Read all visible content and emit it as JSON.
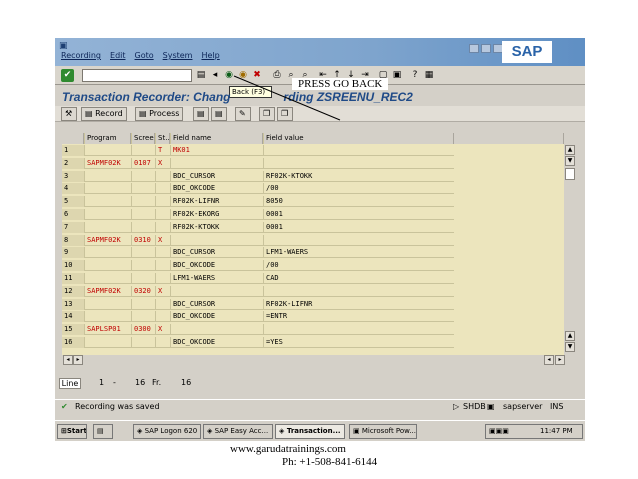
{
  "menu": [
    "Recording",
    "Edit",
    "Goto",
    "System",
    "Help"
  ],
  "logo": "SAP",
  "tooltip": "Back  (F3)",
  "page_title": "Transaction Recorder: Chang",
  "page_title_tail": "rding ZSREENU_REC2",
  "app_toolbar": {
    "record": "Record",
    "process": "Process"
  },
  "annotation": "PRESS GO BACK",
  "table": {
    "headers": [
      "",
      "Program",
      "Screen",
      "St..",
      "Field name",
      "Field value"
    ],
    "rows": [
      [
        "1",
        "",
        "",
        "T",
        "MK01",
        ""
      ],
      [
        "2",
        "SAPMF02K",
        "0107",
        "X",
        "",
        ""
      ],
      [
        "3",
        "",
        "",
        "",
        "BDC_CURSOR",
        "RF02K-KTOKK"
      ],
      [
        "4",
        "",
        "",
        "",
        "BDC_OKCODE",
        "/00"
      ],
      [
        "5",
        "",
        "",
        "",
        "RF02K-LIFNR",
        "8050"
      ],
      [
        "6",
        "",
        "",
        "",
        "RF02K-EKORG",
        "0001"
      ],
      [
        "7",
        "",
        "",
        "",
        "RF02K-KTOKK",
        "0001"
      ],
      [
        "8",
        "SAPMF02K",
        "0310",
        "X",
        "",
        ""
      ],
      [
        "9",
        "",
        "",
        "",
        "BDC_CURSOR",
        "LFM1-WAERS"
      ],
      [
        "10",
        "",
        "",
        "",
        "BDC_OKCODE",
        "/00"
      ],
      [
        "11",
        "",
        "",
        "",
        "LFM1-WAERS",
        "CAD"
      ],
      [
        "12",
        "SAPMF02K",
        "0320",
        "X",
        "",
        ""
      ],
      [
        "13",
        "",
        "",
        "",
        "BDC_CURSOR",
        "RF02K-LIFNR"
      ],
      [
        "14",
        "",
        "",
        "",
        "BDC_OKCODE",
        "=ENTR"
      ],
      [
        "15",
        "SAPLSP01",
        "0300",
        "X",
        "",
        ""
      ],
      [
        "16",
        "",
        "",
        "",
        "BDC_OKCODE",
        "=YES"
      ]
    ]
  },
  "position": {
    "label": "Line",
    "from": "1",
    "to": "16",
    "fr_label": "Fr.",
    "total": "16"
  },
  "status": {
    "message": "Recording was saved",
    "system": "SHDB",
    "server": "sapserver",
    "mode": "INS"
  },
  "taskbar": {
    "start": "Start",
    "items": [
      "SAP Logon 620",
      "SAP Easy Acc...",
      "Transaction...",
      "Microsoft Pow..."
    ],
    "clock": "11:47 PM"
  },
  "footer": {
    "website": "www.garudatrainings.com",
    "phone": "Ph: +1-508-841-6144"
  }
}
